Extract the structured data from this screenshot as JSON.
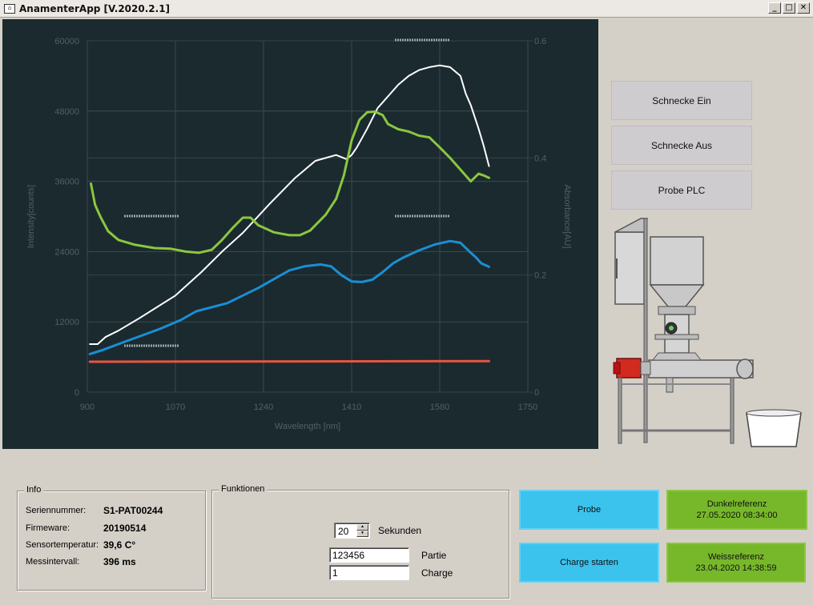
{
  "window": {
    "title": "AnamenterApp [V.2020.2.1]",
    "controls": [
      "minimize-icon",
      "maximize-icon",
      "close-icon"
    ]
  },
  "chart_data": {
    "type": "line",
    "xlabel": "Wavelength [nm]",
    "ylabel": "Intensity[counts]",
    "y2label": "Absorbance[AU]",
    "xlim": [
      900,
      1750
    ],
    "ylim": [
      0,
      60000
    ],
    "y2lim": [
      0,
      0.6
    ],
    "xticks": [
      "900",
      "1070",
      "1240",
      "1410",
      "1580",
      "1750"
    ],
    "yticks": [
      "0",
      "12000",
      "24000",
      "36000",
      "48000",
      "60000"
    ],
    "y2ticks": [
      "0",
      "0.2",
      "0.4",
      "0.6"
    ],
    "grid": true,
    "background": "#1b2a2f",
    "legend_placeholders": 4,
    "series": [
      {
        "color": "#ffffff",
        "axis": "left",
        "x": [
          905,
          920,
          935,
          960,
          1000,
          1070,
          1120,
          1160,
          1200,
          1250,
          1300,
          1340,
          1380,
          1400,
          1410,
          1420,
          1440,
          1460,
          1480,
          1500,
          1520,
          1540,
          1560,
          1580,
          1600,
          1620,
          1630,
          1640,
          1655,
          1665,
          1675
        ],
        "values": [
          8200,
          8200,
          9400,
          10500,
          12600,
          16500,
          20500,
          24000,
          27200,
          32000,
          36500,
          39500,
          40500,
          39800,
          40500,
          41800,
          45000,
          48500,
          50500,
          52500,
          54000,
          55000,
          55500,
          55800,
          55500,
          54000,
          51000,
          49000,
          45000,
          42000,
          38600
        ]
      },
      {
        "color": "#8cc63f",
        "axis": "left",
        "x": [
          907,
          915,
          925,
          940,
          960,
          990,
          1030,
          1060,
          1090,
          1115,
          1140,
          1160,
          1180,
          1200,
          1215,
          1230,
          1260,
          1290,
          1310,
          1330,
          1360,
          1380,
          1395,
          1410,
          1425,
          1440,
          1455,
          1470,
          1480,
          1500,
          1520,
          1540,
          1560,
          1580,
          1600,
          1620,
          1640,
          1655,
          1665,
          1675
        ],
        "values": [
          35600,
          32000,
          30000,
          27500,
          26000,
          25200,
          24600,
          24500,
          24000,
          23800,
          24300,
          26000,
          28000,
          29800,
          29800,
          28500,
          27300,
          26800,
          26800,
          27600,
          30300,
          33000,
          37000,
          43000,
          46500,
          47800,
          47900,
          47300,
          45800,
          44900,
          44500,
          43800,
          43500,
          41800,
          40000,
          38000,
          36000,
          37300,
          37000,
          36600
        ]
      },
      {
        "color": "#1a8fd4",
        "axis": "left",
        "x": [
          905,
          930,
          960,
          1000,
          1040,
          1080,
          1110,
          1140,
          1170,
          1200,
          1230,
          1260,
          1290,
          1320,
          1350,
          1370,
          1390,
          1410,
          1430,
          1450,
          1470,
          1490,
          1510,
          1540,
          1570,
          1600,
          1620,
          1640,
          1650,
          1660,
          1675
        ],
        "values": [
          6500,
          7200,
          8200,
          9500,
          10800,
          12300,
          13800,
          14500,
          15200,
          16500,
          17800,
          19300,
          20800,
          21500,
          21800,
          21500,
          20000,
          18900,
          18800,
          19200,
          20500,
          22000,
          23000,
          24200,
          25200,
          25800,
          25500,
          23800,
          23000,
          22000,
          21400
        ]
      },
      {
        "color": "#e8553f",
        "axis": "left",
        "x": [
          905,
          1675
        ],
        "values": [
          5200,
          5300
        ]
      }
    ]
  },
  "controls": {
    "screw_on": "Schnecke Ein",
    "screw_off": "Schnecke Aus",
    "sample_plc": "Probe PLC"
  },
  "info": {
    "title": "Info",
    "rows": [
      {
        "label": "Seriennummer:",
        "value": "S1-PAT00244"
      },
      {
        "label": "Firmeware:",
        "value": "20190514"
      },
      {
        "label": "Sensortemperatur:",
        "value": "39,6 C°"
      },
      {
        "label": "Messintervall:",
        "value": "396 ms"
      }
    ]
  },
  "functions": {
    "title": "Funktionen",
    "seconds_value": "20",
    "seconds_label": "Sekunden",
    "partie_value": "123456",
    "partie_label": "Partie",
    "charge_value": "1",
    "charge_label": "Charge"
  },
  "actions": {
    "probe": "Probe",
    "charge_start": "Charge starten",
    "dark_ref_label": "Dunkelreferenz",
    "dark_ref_date": "27.05.2020 08:34:00",
    "white_ref_label": "Weissreferenz",
    "white_ref_date": "23.04.2020 14:38:59"
  },
  "colors": {
    "button_blue": "#3bc3ee",
    "button_green": "#76b82a",
    "chart_bg": "#1b2a2f",
    "control_button": "#cfccd0"
  }
}
